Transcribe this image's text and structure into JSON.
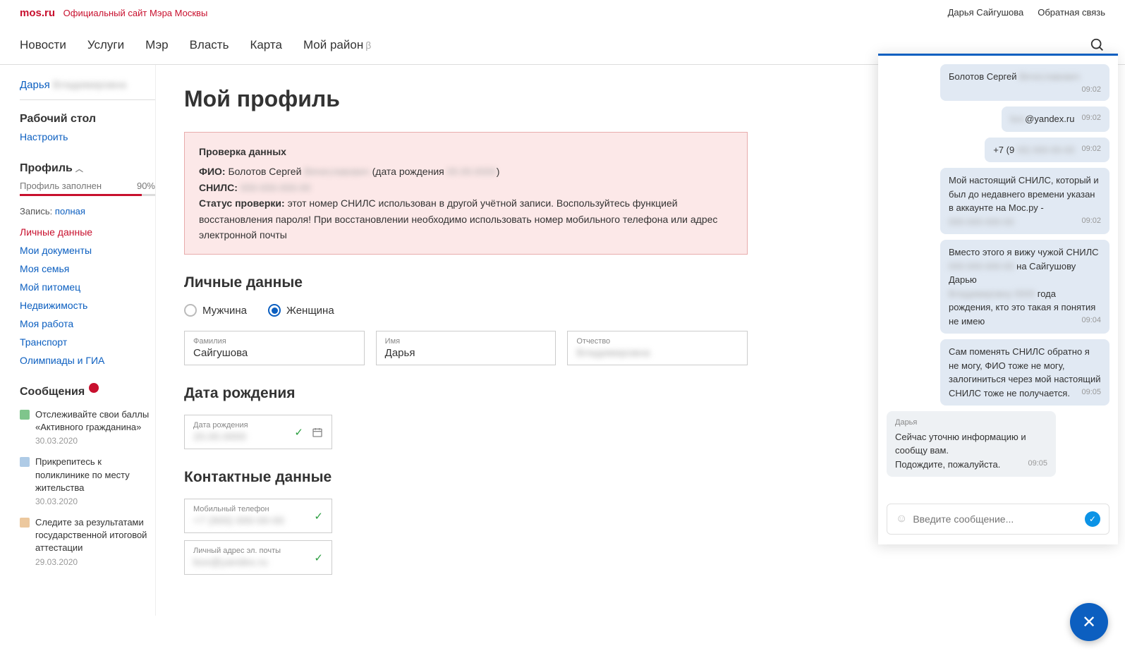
{
  "header": {
    "logo": "mos.ru",
    "logo_sub": "Официальный сайт Мэра Москвы",
    "user": "Дарья Сайгушова",
    "feedback": "Обратная связь"
  },
  "nav": {
    "items": [
      "Новости",
      "Услуги",
      "Мэр",
      "Власть",
      "Карта",
      "Мой район"
    ],
    "beta": "β"
  },
  "sidebar": {
    "user_first": "Дарья",
    "user_last_blur": "Владимировна",
    "desktop": "Рабочий стол",
    "configure": "Настроить",
    "profile": "Профиль",
    "progress_label": "Профиль заполнен",
    "progress_pct": "90%",
    "record_label": "Запись:",
    "record_value": "полная",
    "links": [
      "Личные данные",
      "Мои документы",
      "Моя семья",
      "Мой питомец",
      "Недвижимость",
      "Моя работа",
      "Транспорт",
      "Олимпиады и ГИА"
    ],
    "messages_head": "Сообщения",
    "news": [
      {
        "title": "Отслеживайте свои баллы «Активного гражданина»",
        "date": "30.03.2020",
        "color": "#2a9e3f"
      },
      {
        "title": "Прикрепитесь к поликлинике по месту жительства",
        "date": "30.03.2020",
        "color": "#7aa8d6"
      },
      {
        "title": "Следите за результатами государственной итоговой аттестации",
        "date": "29.03.2020",
        "color": "#e0a45e"
      }
    ]
  },
  "main": {
    "title": "Мой профиль",
    "alert": {
      "title": "Проверка данных",
      "fio_label": "ФИО:",
      "fio_value": "Болотов Сергей",
      "fio_blur": "Вячеславович",
      "dob_paren": "(дата рождения",
      "dob_blur": "00.00.0000",
      "snils_label": "СНИЛС:",
      "snils_blur": "000-000-000-00",
      "status_label": "Статус проверки:",
      "status_text": "этот номер СНИЛС использован в другой учётной записи. Воспользуйтесь функцией восстановления пароля! При восстановлении необходимо использовать номер мобильного телефона или адрес электронной почты"
    },
    "personal": {
      "heading": "Личные данные",
      "male": "Мужчина",
      "female": "Женщина",
      "surname_label": "Фамилия",
      "surname_value": "Сайгушова",
      "name_label": "Имя",
      "name_value": "Дарья",
      "patronymic_label": "Отчество",
      "patronymic_blur": "Владимировна"
    },
    "dob": {
      "heading": "Дата рождения",
      "label": "Дата рождения",
      "value_blur": "20.00.0000"
    },
    "contacts": {
      "heading": "Контактные данные",
      "phone_label": "Мобильный телефон",
      "phone_blur": "+7 (900) 000-00-00",
      "email_label": "Личный адрес эл. почты",
      "email_blur": "box@yandex.ru"
    }
  },
  "chat": {
    "messages_sent": [
      {
        "text": "Болотов Сергей",
        "blur": "Вячеславович",
        "time": "09:02"
      },
      {
        "text": "",
        "blur_prefix": "box",
        "text2": "@yandex.ru",
        "time": "09:02"
      },
      {
        "text": "+7 (9",
        "blur": "00) 000-00-00",
        "time": "09:02"
      },
      {
        "text": "Мой настоящий СНИЛС, который и был до недавнего времени указан в аккаунте на Мос.ру -",
        "blur2": "000-000-000-00",
        "time": "09:02"
      },
      {
        "text": "Вместо этого я вижу чужой СНИЛС ",
        "blur": "000-000-000-00",
        "text2": " на Сайгушову Дарью ",
        "blur2": "Владимировну 0000",
        "text3": " года рождения, кто это такая я понятия не имею",
        "time": "09:04"
      },
      {
        "text": "Сам поменять СНИЛС обратно я не могу, ФИО тоже не могу, залогиниться через мой настоящий СНИЛС тоже не получается.",
        "time": "09:05"
      }
    ],
    "agent": {
      "name": "Дарья",
      "text": "Сейчас уточню информацию и сообщу вам.\nПодождите, пожалуйста.",
      "time": "09:05"
    },
    "input_placeholder": "Введите сообщение..."
  }
}
